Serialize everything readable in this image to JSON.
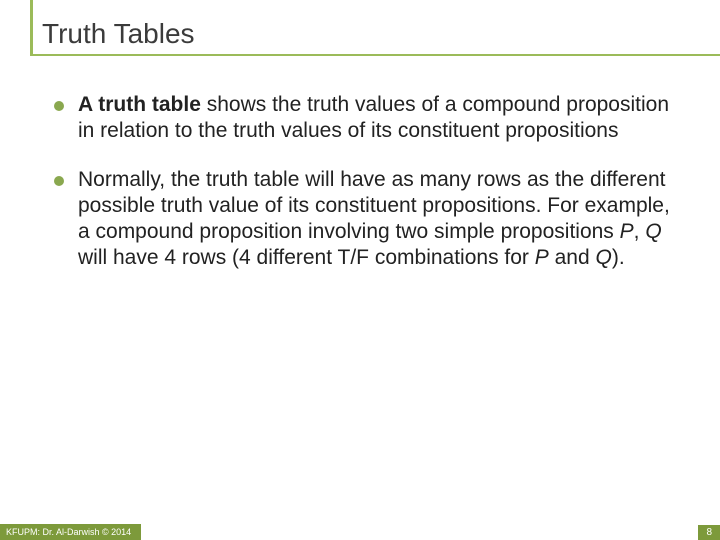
{
  "title": "Truth Tables",
  "bullets": [
    {
      "bold_lead": "A truth table",
      "rest": " shows the truth values of a compound proposition in relation to the truth values of its constituent propositions"
    },
    {
      "text_before_italics": "Normally, the truth table will have as many rows as the different possible truth value of its constituent propositions. For example, a compound proposition involving two simple propositions ",
      "italic1": "P",
      "mid1": ", ",
      "italic2": "Q",
      "mid2": " will have 4 rows (4 different T/F combinations for ",
      "italic3": "P",
      "mid3": " and ",
      "italic4": "Q",
      "tail": ")."
    }
  ],
  "footer": {
    "left": "KFUPM: Dr. Al-Darwish © 2014",
    "right": "8"
  },
  "colors": {
    "accent": "#9bbb59",
    "bullet": "#8aa84f",
    "footer": "#7d9a3b"
  }
}
